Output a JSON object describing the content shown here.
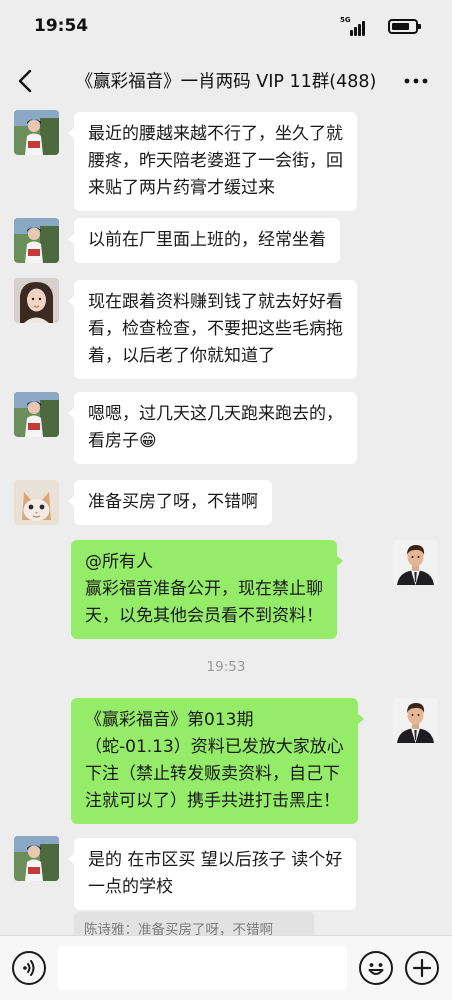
{
  "status_bar": {
    "time": "19:54",
    "network": "5G",
    "battery_level": 0.75
  },
  "header": {
    "title": "《赢彩福音》一肖两码 VIP 11群(488)"
  },
  "messages": [
    {
      "side": "left",
      "avatar": "girl-photo-avatar",
      "lines": [
        "最近的腰越来越不行了，坐久了就",
        "腰疼，昨天陪老婆逛了一会街，回",
        "来贴了两片药膏才缓过来"
      ]
    },
    {
      "side": "left",
      "avatar": "girl-photo-avatar",
      "lines": [
        "以前在厂里面上班的，经常坐着"
      ]
    },
    {
      "side": "left",
      "avatar": "woman-portrait-avatar",
      "lines": [
        "现在跟着资料赚到钱了就去好好看",
        "看，检查检查，不要把这些毛病拖",
        "着，以后老了你就知道了"
      ]
    },
    {
      "side": "left",
      "avatar": "girl-photo-avatar",
      "lines": [
        "嗯嗯，过几天这几天跑来跑去的，",
        "看房子😁"
      ]
    },
    {
      "side": "left",
      "avatar": "cat-avatar",
      "lines": [
        "准备买房了呀，不错啊"
      ]
    },
    {
      "side": "right",
      "avatar": "man-suit-avatar",
      "lines": [
        "@所有人",
        "赢彩福音准备公开，现在禁止聊",
        "天，以免其他会员看不到资料！"
      ]
    },
    {
      "side": "right",
      "avatar": "man-suit-avatar",
      "lines": [
        "《赢彩福音》第013期",
        "（蛇-01.13）资料已发放大家放心",
        "下注（禁止转发贩卖资料，自己下",
        "注就可以了）携手共进打击黑庄！"
      ]
    },
    {
      "side": "left",
      "avatar": "girl-photo-avatar",
      "lines": [
        "是的 在市区买 望以后孩子 读个好",
        "一点的学校"
      ]
    }
  ],
  "timestamp": "19:53",
  "quote": "陈诗雅：准备买房了呀，不错啊",
  "input": {
    "value": ""
  },
  "colors": {
    "background": "#ededed",
    "bubble_self": "#95ec69",
    "bubble_other": "#ffffff"
  }
}
